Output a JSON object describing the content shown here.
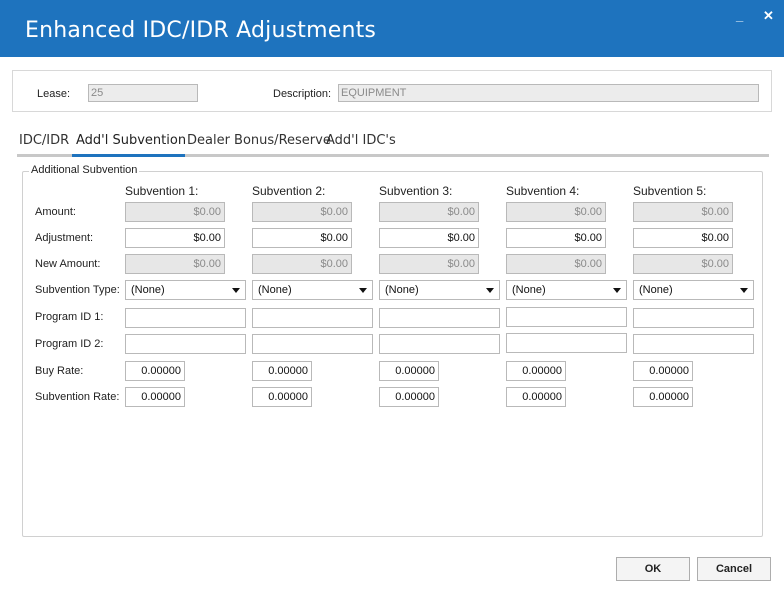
{
  "window": {
    "title": "Enhanced IDC/IDR Adjustments",
    "minimize_glyph": "_",
    "close_glyph": "✕"
  },
  "header": {
    "lease_label": "Lease:",
    "lease_value": "25",
    "description_label": "Description:",
    "description_value": "EQUIPMENT"
  },
  "tabs": [
    {
      "label": "IDC/IDR",
      "active": false
    },
    {
      "label": "Add'l Subvention",
      "active": true
    },
    {
      "label": "Dealer Bonus/Reserve",
      "active": false
    },
    {
      "label": "Add'l IDC's",
      "active": false
    }
  ],
  "group": {
    "title": "Additional Subvention",
    "row_labels": {
      "amount": "Amount:",
      "adjustment": "Adjustment:",
      "new_amount": "New Amount:",
      "subvention_type": "Subvention Type:",
      "program_id_1": "Program ID 1:",
      "program_id_2": "Program ID 2:",
      "buy_rate": "Buy Rate:",
      "subvention_rate": "Subvention Rate:"
    },
    "columns": [
      {
        "header": "Subvention 1:",
        "amount": "$0.00",
        "adjustment": "$0.00",
        "new_amount": "$0.00",
        "type": "(None)",
        "program_id_1": "",
        "program_id_2": "",
        "buy_rate": "0.00000",
        "subvention_rate": "0.00000"
      },
      {
        "header": "Subvention 2:",
        "amount": "$0.00",
        "adjustment": "$0.00",
        "new_amount": "$0.00",
        "type": "(None)",
        "program_id_1": "",
        "program_id_2": "",
        "buy_rate": "0.00000",
        "subvention_rate": "0.00000"
      },
      {
        "header": "Subvention 3:",
        "amount": "$0.00",
        "adjustment": "$0.00",
        "new_amount": "$0.00",
        "type": "(None)",
        "program_id_1": "",
        "program_id_2": "",
        "buy_rate": "0.00000",
        "subvention_rate": "0.00000"
      },
      {
        "header": "Subvention 4:",
        "amount": "$0.00",
        "adjustment": "$0.00",
        "new_amount": "$0.00",
        "type": "(None)",
        "program_id_1": "",
        "program_id_2": "",
        "buy_rate": "0.00000",
        "subvention_rate": "0.00000"
      },
      {
        "header": "Subvention 5:",
        "amount": "$0.00",
        "adjustment": "$0.00",
        "new_amount": "$0.00",
        "type": "(None)",
        "program_id_1": "",
        "program_id_2": "",
        "buy_rate": "0.00000",
        "subvention_rate": "0.00000"
      }
    ]
  },
  "buttons": {
    "ok": "OK",
    "cancel": "Cancel"
  },
  "colors": {
    "titlebar": "#1e73be",
    "accent": "#1e73be"
  }
}
